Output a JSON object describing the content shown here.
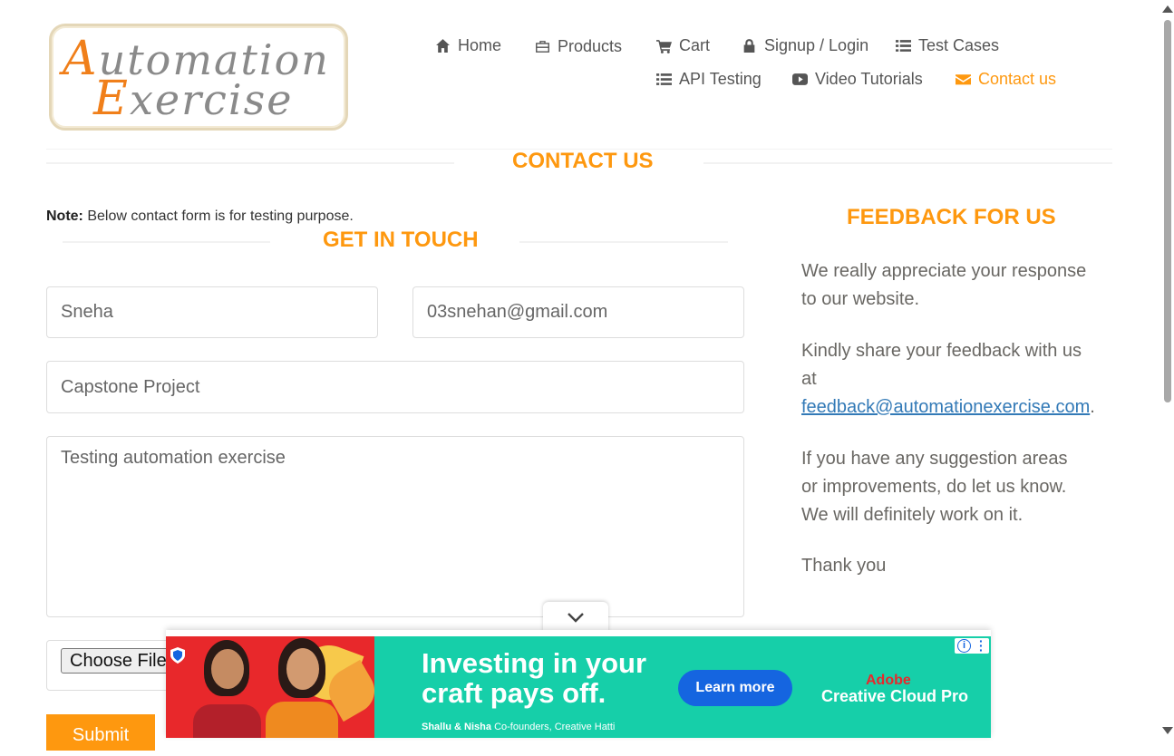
{
  "logo": {
    "line1_first": "A",
    "line1_rest": "utomation",
    "line2_first": "E",
    "line2_rest": "xercise"
  },
  "nav": {
    "home": "Home",
    "products": "Products",
    "cart": "Cart",
    "signup_login": "Signup / Login",
    "test_cases": "Test Cases",
    "api_testing": "API Testing",
    "video_tutorials": "Video Tutorials",
    "contact_us": "Contact us"
  },
  "page": {
    "title": "CONTACT US",
    "note_label": "Note:",
    "note_text": " Below contact form is for testing purpose."
  },
  "form": {
    "heading": "GET IN TOUCH",
    "name_value": "Sneha",
    "email_value": "03snehan@gmail.com",
    "subject_value": "Capstone Project",
    "message_value": "Testing automation exercise",
    "choose_file": "Choose File",
    "submit": "Submit"
  },
  "feedback": {
    "heading": "FEEDBACK FOR US",
    "p1": "We really appreciate your response to our website.",
    "p2_prefix": "Kindly share your feedback with us at ",
    "p2_link": "feedback@automationexercise.com",
    "p2_suffix": ".",
    "p3": "If you have any suggestion areas or improvements, do let us know. We will definitely work on it.",
    "p4": "Thank you"
  },
  "ad": {
    "headline_line1": "Investing in your",
    "headline_line2": "craft pays off.",
    "names": "Shallu & Nisha",
    "role": " Co-founders, Creative Hatti",
    "cta": "Learn more",
    "brand_line1": "Adobe",
    "brand_line2": "Creative Cloud Pro"
  },
  "colors": {
    "accent": "#fe980f",
    "link": "#337ab7",
    "ad_bg": "#16cfa9",
    "ad_cta": "#1565e0"
  }
}
